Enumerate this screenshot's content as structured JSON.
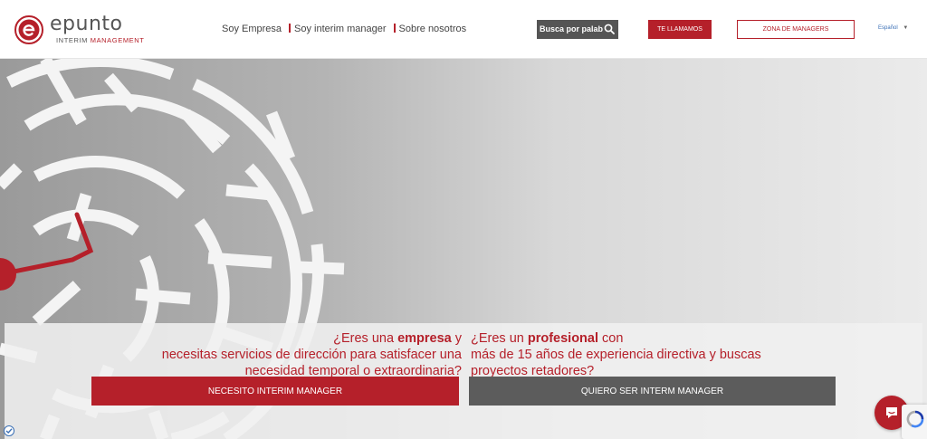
{
  "header": {
    "logo": {
      "wordmark": "epunto",
      "sub_left": "INTERIM",
      "sub_right": "MANAGEMENT"
    },
    "nav": [
      {
        "label": "Soy Empresa"
      },
      {
        "label": "Soy interim manager"
      },
      {
        "label": "Sobre nosotros"
      }
    ],
    "search": {
      "placeholder": "Busca por palabras clave"
    },
    "call_label": "TE LLAMAMOS",
    "zone_label": "ZONA DE MANAGERS",
    "language": "Español"
  },
  "hero": {
    "left": {
      "line1_prefix": "¿Eres una ",
      "line1_strong": "empresa",
      "line1_suffix": " y",
      "line2": "necesitas servicios de dirección para satisfacer una",
      "line3": "necesidad temporal o extraordinaria?",
      "cta": "NECESITO INTERIM MANAGER"
    },
    "right": {
      "line1_prefix": "¿Eres un ",
      "line1_strong": "profesional",
      "line1_suffix": " con",
      "line2": "más de 15 años de experiencia directiva y buscas",
      "line3": "proyectos retadores?",
      "cta": "QUIERO SER INTERM MANAGER"
    }
  },
  "colors": {
    "brand": "#b5202a",
    "dark_button": "#5c5c5c",
    "link": "#3a6fb5"
  },
  "icons": [
    "logo-e-icon",
    "search-icon",
    "chevron-down-icon",
    "chat-icon",
    "recaptcha-icon",
    "cookie-check-icon"
  ]
}
